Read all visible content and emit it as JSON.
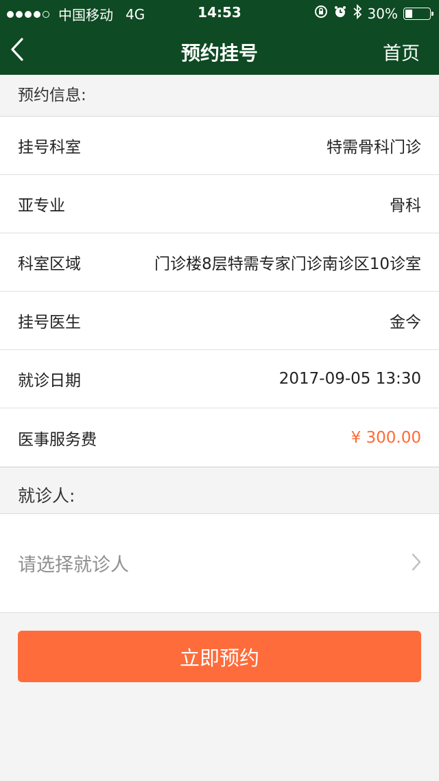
{
  "status_bar": {
    "carrier": "中国移动",
    "network": "4G",
    "time": "14:53",
    "battery": "30%",
    "battery_level": 0.3
  },
  "nav": {
    "title": "预约挂号",
    "home_label": "首页"
  },
  "booking_section": {
    "header": "预约信息:",
    "rows": [
      {
        "label": "挂号科室",
        "value": "特需骨科门诊"
      },
      {
        "label": "亚专业",
        "value": "骨科"
      },
      {
        "label": "科室区域",
        "value": "门诊楼8层特需专家门诊南诊区10诊室"
      },
      {
        "label": "挂号医生",
        "value": "金今"
      },
      {
        "label": "就诊日期",
        "value": "2017-09-05 13:30"
      },
      {
        "label": "医事服务费",
        "value": "¥ 300.00"
      }
    ]
  },
  "patient_section": {
    "header": "就诊人:",
    "placeholder": "请选择就诊人"
  },
  "submit_label": "立即预约",
  "colors": {
    "header_bg": "#0e4a23",
    "accent": "#ff6c3b",
    "fee": "#ff6a35"
  }
}
